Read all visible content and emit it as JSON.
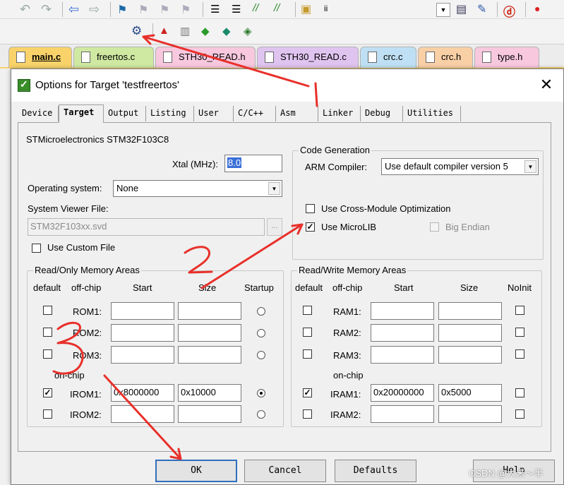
{
  "ide": {
    "target_name": "testfreertos",
    "toolbar_ii": "ii",
    "file_tabs": [
      {
        "label": "main.c",
        "color": "#f9d36a",
        "active": true
      },
      {
        "label": "freertos.c",
        "color": "#cfe9a2"
      },
      {
        "label": "STH30_READ.h",
        "color": "#f7c8de"
      },
      {
        "label": "STH30_READ.c",
        "color": "#e0c4f0"
      },
      {
        "label": "crc.c",
        "color": "#bfe0f4"
      },
      {
        "label": "crc.h",
        "color": "#f9cfa6"
      },
      {
        "label": "type.h",
        "color": "#f7c8de"
      }
    ]
  },
  "dialog": {
    "title": "Options for Target 'testfreertos'",
    "close_glyph": "✕",
    "tabs": [
      "Device",
      "Target",
      "Output",
      "Listing",
      "User",
      "C/C++",
      "Asm",
      "Linker",
      "Debug",
      "Utilities"
    ],
    "selected_tab": "Target",
    "device_name": "STMicroelectronics STM32F103C8",
    "xtal_label": "Xtal (MHz):",
    "xtal_value": "8.0",
    "os_label": "Operating system:",
    "os_value": "None",
    "svd_label": "System Viewer File:",
    "svd_value": "STM32F103xx.svd",
    "browse_label": "...",
    "custom_file_label": "Use Custom File",
    "codegen": {
      "title": "Code Generation",
      "compiler_label": "ARM Compiler:",
      "compiler_value": "Use default compiler version 5",
      "cross_module_label": "Use Cross-Module Optimization",
      "cross_module_checked": false,
      "microlib_label": "Use MicroLIB",
      "microlib_checked": true,
      "big_endian_label": "Big Endian",
      "big_endian_checked": false
    },
    "ro_memory": {
      "title": "Read/Only Memory Areas",
      "headers": {
        "default": "default",
        "offchip": "off-chip",
        "start": "Start",
        "size": "Size",
        "last": "Startup"
      },
      "onchip_label": "on-chip",
      "rows": [
        {
          "name": "ROM1:",
          "checked": false,
          "start": "",
          "size": "",
          "radio": false
        },
        {
          "name": "ROM2:",
          "checked": false,
          "start": "",
          "size": "",
          "radio": false
        },
        {
          "name": "ROM3:",
          "checked": false,
          "start": "",
          "size": "",
          "radio": false
        },
        {
          "name": "IROM1:",
          "checked": true,
          "start": "0x8000000",
          "size": "0x10000",
          "radio": true
        },
        {
          "name": "IROM2:",
          "checked": false,
          "start": "",
          "size": "",
          "radio": false
        }
      ]
    },
    "rw_memory": {
      "title": "Read/Write Memory Areas",
      "headers": {
        "default": "default",
        "offchip": "off-chip",
        "start": "Start",
        "size": "Size",
        "last": "NoInit"
      },
      "onchip_label": "on-chip",
      "rows": [
        {
          "name": "RAM1:",
          "checked": false,
          "start": "",
          "size": "",
          "noinit": false
        },
        {
          "name": "RAM2:",
          "checked": false,
          "start": "",
          "size": "",
          "noinit": false
        },
        {
          "name": "RAM3:",
          "checked": false,
          "start": "",
          "size": "",
          "noinit": false
        },
        {
          "name": "IRAM1:",
          "checked": true,
          "start": "0x20000000",
          "size": "0x5000",
          "noinit": false
        },
        {
          "name": "IRAM2:",
          "checked": false,
          "start": "",
          "size": "",
          "noinit": false
        }
      ]
    },
    "buttons": {
      "ok": "OK",
      "cancel": "Cancel",
      "defaults": "Defaults",
      "help": "Help"
    }
  },
  "watermark": "CSDN @大米～半",
  "annotations": {
    "color": "#e8302a",
    "marks": [
      "1",
      "2",
      "3"
    ]
  }
}
